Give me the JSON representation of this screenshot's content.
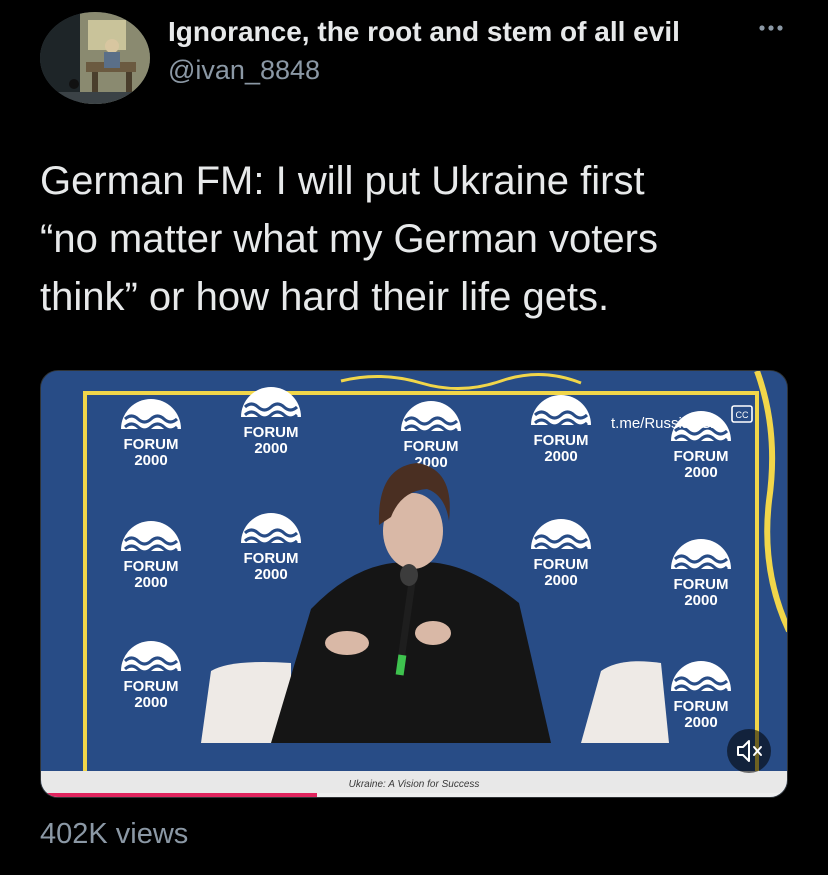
{
  "author": {
    "display_name": "Ignorance, the root and stem of all evil",
    "handle": "@ivan_8848"
  },
  "icons": {
    "more": "more-horizontal-icon",
    "closed_captions": "cc-icon",
    "mute": "speaker-muted-icon"
  },
  "tweet": {
    "lines": [
      "German FM: I will put Ukraine first",
      "“no matter what my German voters",
      "think” or how hard their life gets."
    ]
  },
  "media": {
    "watermark": "t.me/RussiaUSA",
    "caption": "Ukraine: A Vision for Success",
    "backdrop_text": "FORUM",
    "backdrop_year": "2000",
    "progress_fraction": 0.37,
    "colors": {
      "backdrop": "#284c86",
      "frame": "#f1d64a",
      "progress": "#e0245e"
    }
  },
  "stats": {
    "views": "402K views"
  }
}
